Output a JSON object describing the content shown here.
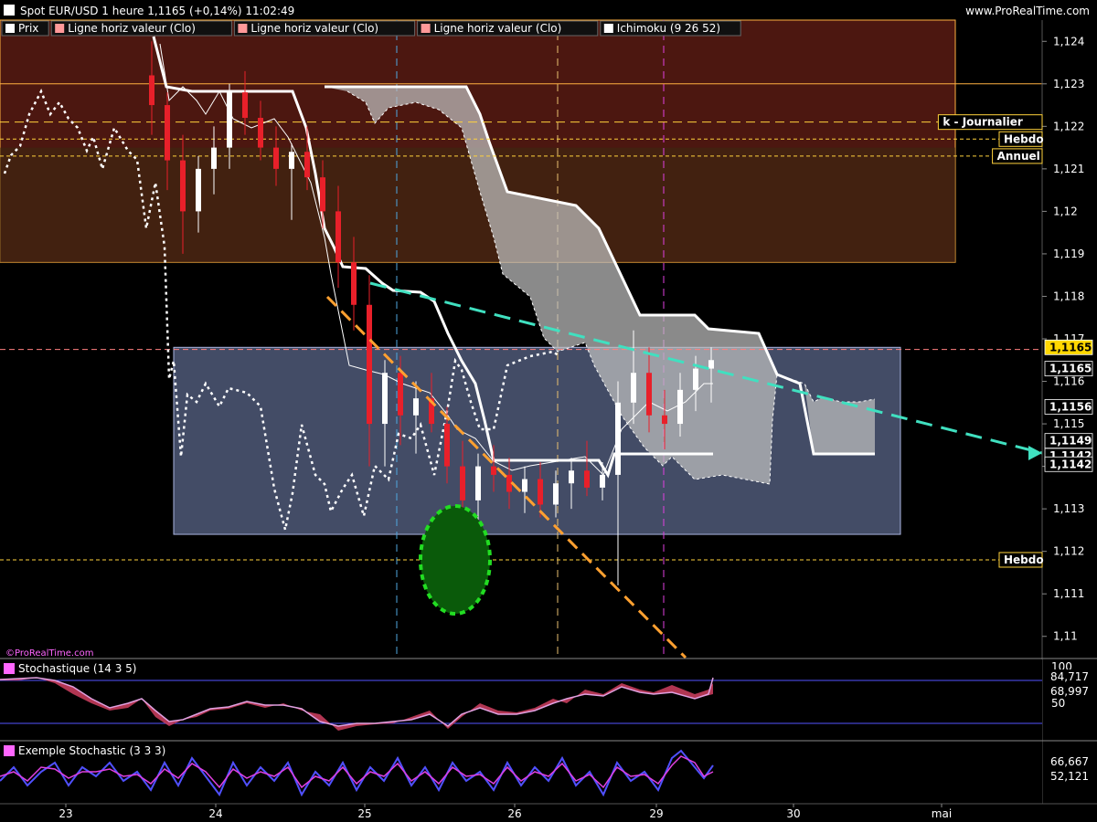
{
  "header": {
    "title": "Spot EUR/USD 1 heure 1,1165 (+0,14%) 11:02:49",
    "site": "www.ProRealTime.com"
  },
  "legend": [
    {
      "label": "Prix",
      "color": "#ffffff"
    },
    {
      "label": "Ligne horiz valeur (Clo)",
      "color": "#ff9999"
    },
    {
      "label": "Ligne horiz valeur (Clo)",
      "color": "#ff9999"
    },
    {
      "label": "Ligne horiz valeur (Clo)",
      "color": "#ff9999"
    },
    {
      "label": "Ichimoku (9 26 52)",
      "color": "#ffffff"
    }
  ],
  "watermark": "©ProRealTime.com",
  "levels": [
    {
      "label": "k - Journalier",
      "value": 1.1221,
      "color": "#ffd23c"
    },
    {
      "label": "Hebdo",
      "value": 1.1217,
      "color": "#ffd23c"
    },
    {
      "label": "Annuel",
      "value": 1.1213,
      "color": "#ffd23c"
    },
    {
      "label": "Hebdo",
      "value": 1.1118,
      "color": "#ffd23c"
    }
  ],
  "price_badges": [
    {
      "label": "1,1165",
      "value": 1.1168,
      "bg": "#ffd700",
      "fg": "#000000"
    },
    {
      "label": "1,1165",
      "value": 1.1163,
      "bg": "#000000",
      "fg": "#ffffff"
    },
    {
      "label": "1,1156",
      "value": 1.1154,
      "bg": "#000000",
      "fg": "#ffffff"
    },
    {
      "label": "1,1149",
      "value": 1.1146,
      "bg": "#000000",
      "fg": "#ffffff"
    },
    {
      "label": "1,1142",
      "value": 1.11425,
      "bg": "#000000",
      "fg": "#ffffff"
    },
    {
      "label": "1,1142",
      "value": 1.11405,
      "bg": "#000000",
      "fg": "#ffffff"
    }
  ],
  "stoch_panel": {
    "title": "Stochastique (14 3 5)",
    "scale_labels": [
      "100",
      "50"
    ],
    "values": [
      {
        "label": "84,717",
        "color": "#ff66ff"
      },
      {
        "label": "68,997",
        "color": "#ff8080"
      }
    ]
  },
  "example_panel": {
    "title": "Exemple Stochastic (3 3 3)",
    "values": [
      {
        "label": "66,667",
        "color": "#ff66ff"
      },
      {
        "label": "52,121",
        "color": "#ff66ff"
      }
    ]
  },
  "chart_data": {
    "type": "candlestick",
    "title": "Spot EUR/USD 1 heure 1,1165 (+0,14%) 11:02:49",
    "ylim": [
      1.1095,
      1.1245
    ],
    "y_ticks": [
      "1,124",
      "1,123",
      "1,122",
      "1,121",
      "1,12",
      "1,119",
      "1,118",
      "1,117",
      "1,116",
      "1,115",
      "1,114",
      "1,113",
      "1,112",
      "1,111",
      "1,11"
    ],
    "x_ticks": [
      "23",
      "24",
      "25",
      "26",
      "29",
      "30",
      "mai"
    ],
    "colors": {
      "up": "#ffffff",
      "down": "#e8202a",
      "accent": "#ffd23c",
      "trend": "#40e0c0",
      "support": "#ffa030"
    },
    "grid": false,
    "zones": [
      {
        "name": "resistance-zone",
        "y1": 1.1245,
        "y2": 1.1188,
        "color": "#8b2a1e"
      },
      {
        "name": "consolidation-zone",
        "y1": 1.1168,
        "y2": 1.1124,
        "color": "#5a6688"
      }
    ],
    "candles": [
      {
        "o": 1.1232,
        "h": 1.124,
        "l": 1.1218,
        "c": 1.1225
      },
      {
        "o": 1.1225,
        "h": 1.1228,
        "l": 1.1205,
        "c": 1.1212
      },
      {
        "o": 1.1212,
        "h": 1.1218,
        "l": 1.119,
        "c": 1.12
      },
      {
        "o": 1.12,
        "h": 1.1213,
        "l": 1.1195,
        "c": 1.121
      },
      {
        "o": 1.121,
        "h": 1.122,
        "l": 1.1204,
        "c": 1.1215
      },
      {
        "o": 1.1215,
        "h": 1.123,
        "l": 1.121,
        "c": 1.1228
      },
      {
        "o": 1.1228,
        "h": 1.1233,
        "l": 1.1218,
        "c": 1.1222
      },
      {
        "o": 1.1222,
        "h": 1.1226,
        "l": 1.1212,
        "c": 1.1215
      },
      {
        "o": 1.1215,
        "h": 1.122,
        "l": 1.1206,
        "c": 1.121
      },
      {
        "o": 1.121,
        "h": 1.1216,
        "l": 1.1198,
        "c": 1.1214
      },
      {
        "o": 1.1214,
        "h": 1.122,
        "l": 1.1205,
        "c": 1.1208
      },
      {
        "o": 1.1208,
        "h": 1.1212,
        "l": 1.1196,
        "c": 1.12
      },
      {
        "o": 1.12,
        "h": 1.1206,
        "l": 1.1182,
        "c": 1.1188
      },
      {
        "o": 1.1188,
        "h": 1.1194,
        "l": 1.1172,
        "c": 1.1178
      },
      {
        "o": 1.1178,
        "h": 1.1185,
        "l": 1.114,
        "c": 1.115
      },
      {
        "o": 1.115,
        "h": 1.1165,
        "l": 1.114,
        "c": 1.1162
      },
      {
        "o": 1.1162,
        "h": 1.1166,
        "l": 1.1145,
        "c": 1.1152
      },
      {
        "o": 1.1152,
        "h": 1.116,
        "l": 1.1143,
        "c": 1.1156
      },
      {
        "o": 1.1156,
        "h": 1.1162,
        "l": 1.1148,
        "c": 1.115
      },
      {
        "o": 1.115,
        "h": 1.1154,
        "l": 1.1136,
        "c": 1.114
      },
      {
        "o": 1.114,
        "h": 1.1146,
        "l": 1.1128,
        "c": 1.1132
      },
      {
        "o": 1.1132,
        "h": 1.1143,
        "l": 1.1126,
        "c": 1.114
      },
      {
        "o": 1.114,
        "h": 1.1145,
        "l": 1.1134,
        "c": 1.1138
      },
      {
        "o": 1.1138,
        "h": 1.1142,
        "l": 1.113,
        "c": 1.1134
      },
      {
        "o": 1.1134,
        "h": 1.114,
        "l": 1.1129,
        "c": 1.1137
      },
      {
        "o": 1.1137,
        "h": 1.1141,
        "l": 1.1128,
        "c": 1.1131
      },
      {
        "o": 1.1131,
        "h": 1.1139,
        "l": 1.1128,
        "c": 1.1136
      },
      {
        "o": 1.1136,
        "h": 1.1142,
        "l": 1.113,
        "c": 1.1139
      },
      {
        "o": 1.1139,
        "h": 1.1146,
        "l": 1.1133,
        "c": 1.1135
      },
      {
        "o": 1.1135,
        "h": 1.1141,
        "l": 1.1132,
        "c": 1.1138
      },
      {
        "o": 1.1138,
        "h": 1.116,
        "l": 1.1112,
        "c": 1.1155
      },
      {
        "o": 1.1155,
        "h": 1.1172,
        "l": 1.115,
        "c": 1.1162
      },
      {
        "o": 1.1162,
        "h": 1.1168,
        "l": 1.1148,
        "c": 1.1152
      },
      {
        "o": 1.1152,
        "h": 1.1158,
        "l": 1.1144,
        "c": 1.115
      },
      {
        "o": 1.115,
        "h": 1.1162,
        "l": 1.1147,
        "c": 1.1158
      },
      {
        "o": 1.1158,
        "h": 1.1166,
        "l": 1.1153,
        "c": 1.1163
      },
      {
        "o": 1.1163,
        "h": 1.1168,
        "l": 1.1155,
        "c": 1.1165
      }
    ]
  }
}
